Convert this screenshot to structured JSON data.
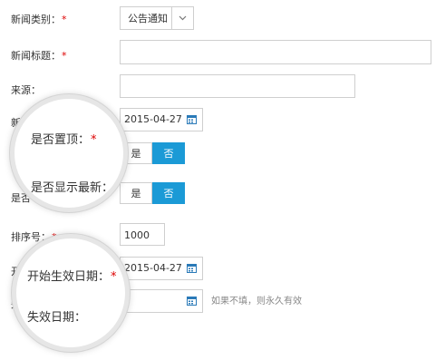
{
  "fields": {
    "category": {
      "label": "新闻类别：",
      "required": "*",
      "value": "公告通知"
    },
    "title": {
      "label": "新闻标题：",
      "required": "*",
      "value": ""
    },
    "source": {
      "label": "来源：",
      "value": ""
    },
    "news_date": {
      "label_fragment": "新闻",
      "value": "2015-04-27"
    },
    "pinned": {
      "yes": "是",
      "no": "否"
    },
    "show_latest": {
      "label_fragment": "是否",
      "yes": "是",
      "no": "否"
    },
    "sort_order": {
      "label": "排序号：",
      "required": "*",
      "value": "1000"
    },
    "start_date": {
      "label_fragment": "开",
      "value": "2015-04-27"
    },
    "end_date": {
      "label_fragment": "失",
      "value": "",
      "hint": "如果不填，则永久有效"
    }
  },
  "magnifier_top": {
    "pinned_label": "是否置顶：",
    "pinned_required": "*",
    "latest_label": "是否显示最新：",
    "latest_required": "*"
  },
  "magnifier_bottom": {
    "start_label": "开始生效日期：",
    "start_required": "*",
    "end_label": "失效日期："
  },
  "colors": {
    "accent": "#1b9ad6",
    "required": "#dd0000"
  },
  "icons": {
    "select_arrow": "chevron-down-icon",
    "date": "calendar-icon"
  }
}
